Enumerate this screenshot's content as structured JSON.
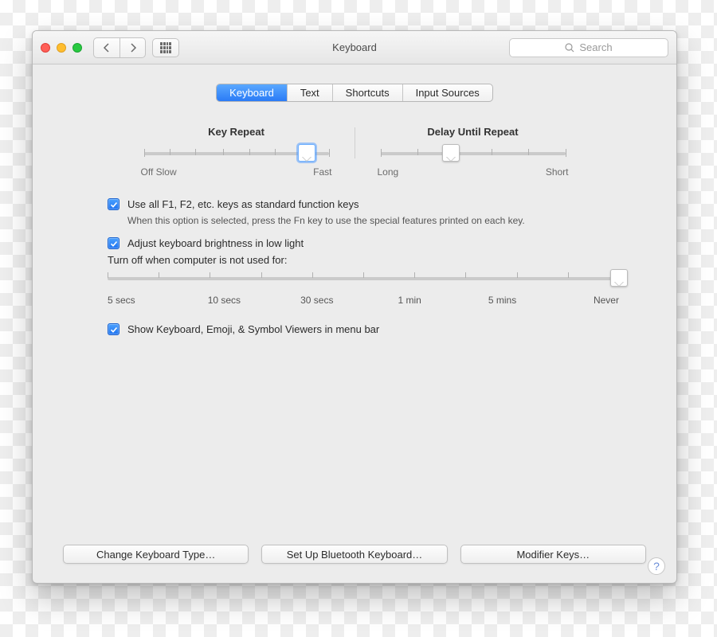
{
  "window": {
    "title": "Keyboard"
  },
  "search": {
    "placeholder": "Search"
  },
  "tabs": [
    "Keyboard",
    "Text",
    "Shortcuts",
    "Input Sources"
  ],
  "sliders": {
    "keyRepeat": {
      "title": "Key Repeat",
      "leftLabel": "Off Slow",
      "rightLabel": "Fast"
    },
    "delay": {
      "title": "Delay Until Repeat",
      "leftLabel": "Long",
      "rightLabel": "Short"
    }
  },
  "opts": {
    "fnKeys": {
      "label": "Use all F1, F2, etc. keys as standard function keys",
      "hint": "When this option is selected, press the Fn key to use the special features printed on each key."
    },
    "brightness": {
      "label": "Adjust keyboard brightness in low light"
    },
    "turnoff": {
      "label": "Turn off when computer is not used for:",
      "ticks": [
        "5 secs",
        "10 secs",
        "30 secs",
        "1 min",
        "5 mins",
        "Never"
      ]
    },
    "viewers": {
      "label": "Show Keyboard, Emoji, & Symbol Viewers in menu bar"
    }
  },
  "buttons": {
    "changeType": "Change Keyboard Type…",
    "bluetooth": "Set Up Bluetooth Keyboard…",
    "modifier": "Modifier Keys…"
  }
}
